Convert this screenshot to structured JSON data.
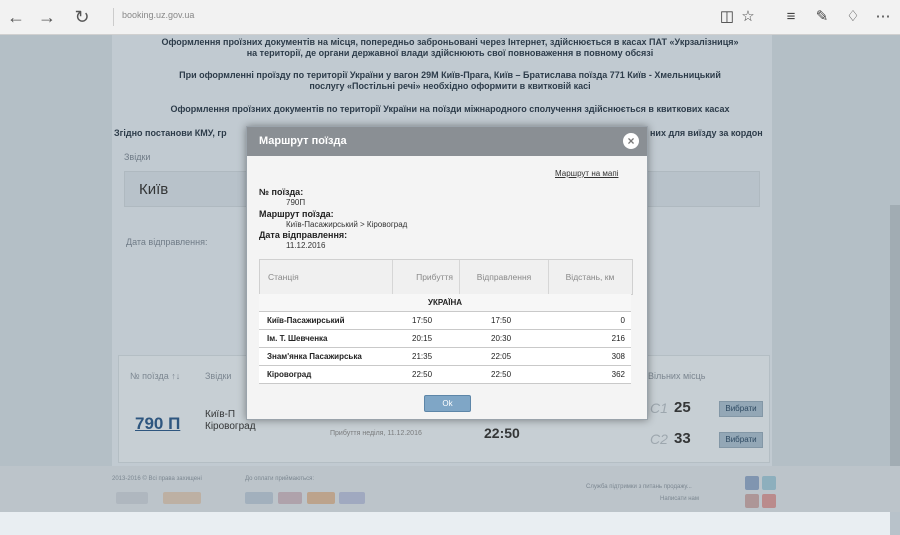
{
  "browser": {
    "url": "booking.uz.gov.ua",
    "icons": [
      "back-icon",
      "forward-icon",
      "refresh-icon",
      "reading-view-icon",
      "favorite-star-icon",
      "hub-icon",
      "web-note-icon",
      "share-icon",
      "more-icon"
    ]
  },
  "notices": [
    "Оформлення проїзних документів на місця, попередньо заброньовані через Інтернет, здійснюється в касах ПАТ «Укрзалізниця»",
    "на території, де органи державної влади здійснюють свої повноваження в повному обсязі",
    "При оформленні проїзду по території України у вагон 29М Київ-Прага, Київ – Братислава поїзда 771 Київ - Хмельницький",
    "послугу «Постільні речі» необхідно оформити в квитковій касі",
    "Оформлення проїзних документів по території України на поїзди міжнародного сполучення здійснюється в квиткових касах",
    "Згідно постанови КМУ, гр",
    "них для виїзду за кордон"
  ],
  "search": {
    "from_label": "Звідки",
    "from_value": "Київ",
    "date_label": "Дата відправлення:"
  },
  "results": {
    "head_train": "№ поїзда ↑↓",
    "head_route": "Звідки",
    "head_seats": "Вільних місць",
    "train_number": "790 П",
    "route_line1": "Київ-П",
    "route_line2": "Кіровоград",
    "arrival_text": "Прибуття    неділя, 11.12.2016",
    "arrival_time": "22:50",
    "seats": [
      {
        "class": "С1",
        "count": "25",
        "button": "Вибрати"
      },
      {
        "class": "С2",
        "count": "33",
        "button": "Вибрати"
      }
    ]
  },
  "footer": {
    "copyright": "2013-2016 © Всі права захищені",
    "payment_label": "До оплати приймаються:",
    "right_text1": "Служба підтримки з питань продажу...",
    "right_text2": "Написати нам"
  },
  "modal": {
    "title": "Маршрут поїзда",
    "map_link": "Маршрут на мапі",
    "train_label": "№ поїзда:",
    "train_value": "790П",
    "route_label": "Маршрут поїзда:",
    "route_value": "Київ-Пасажирський > Кіровоград",
    "date_label": "Дата відправлення:",
    "date_value": "11.12.2016",
    "table": {
      "headers": [
        "Станція",
        "Прибуття",
        "Відправлення",
        "Відстань, км"
      ],
      "country": "УКРАЇНА",
      "rows": [
        {
          "station": "Київ-Пасажирський",
          "arrival": "17:50",
          "departure": "17:50",
          "distance": "0"
        },
        {
          "station": "Ім. Т. Шевченка",
          "arrival": "20:15",
          "departure": "20:30",
          "distance": "216"
        },
        {
          "station": "Знам'янка Пасажирська",
          "arrival": "21:35",
          "departure": "22:05",
          "distance": "308"
        },
        {
          "station": "Кіровоград",
          "arrival": "22:50",
          "departure": "22:50",
          "distance": "362"
        }
      ]
    },
    "ok_button": "Ok"
  }
}
